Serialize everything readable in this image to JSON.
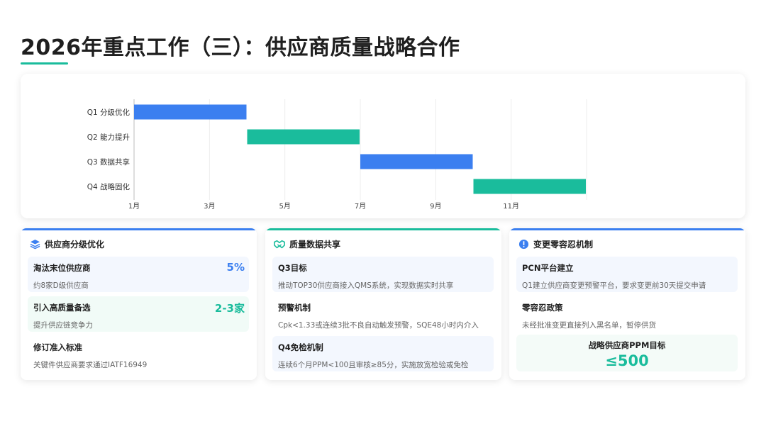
{
  "title": "2026年重点工作（三）：供应商质量战略合作",
  "colors": {
    "blue": "#3b7ff0",
    "green": "#1abc9c",
    "accent_line": "#1abc9c"
  },
  "chart_data": {
    "type": "gantt",
    "tasks": [
      {
        "label": "Q1 分级优化",
        "start": 1,
        "end": 4,
        "color": "#3b7ff0"
      },
      {
        "label": "Q2 能力提升",
        "start": 4,
        "end": 7,
        "color": "#1abc9c"
      },
      {
        "label": "Q3 数据共享",
        "start": 7,
        "end": 10,
        "color": "#3b7ff0"
      },
      {
        "label": "Q4 战略固化",
        "start": 10,
        "end": 13,
        "color": "#1abc9c"
      }
    ],
    "x_ticks": [
      {
        "value": 1,
        "label": "1月"
      },
      {
        "value": 3,
        "label": "3月"
      },
      {
        "value": 5,
        "label": "5月"
      },
      {
        "value": 7,
        "label": "7月"
      },
      {
        "value": 9,
        "label": "9月"
      },
      {
        "value": 11,
        "label": "11月"
      }
    ],
    "xlim": [
      1,
      13
    ],
    "grid": true
  },
  "cards": [
    {
      "title": "供应商分级优化",
      "icon": "layers-icon",
      "items": [
        {
          "title": "淘汰末位供应商",
          "sub": "约8家D级供应商",
          "value": "5%",
          "value_color": "#3b7ff0"
        },
        {
          "title": "引入高质量备选",
          "sub": "提升供应链竞争力",
          "value": "2-3家",
          "value_color": "#1abc9c"
        },
        {
          "title": "修订准入标准",
          "sub": "关键件供应商要求通过IATF16949",
          "value": ""
        }
      ]
    },
    {
      "title": "质量数据共享",
      "icon": "handshake-icon",
      "items": [
        {
          "title": "Q3目标",
          "sub": "推动TOP30供应商接入QMS系统，实现数据实时共享"
        },
        {
          "title": "预警机制",
          "sub": "Cpk<1.33或连续3批不良自动触发预警，SQE48小时内介入"
        },
        {
          "title": "Q4免检机制",
          "sub": "连续6个月PPM<100且审核≥85分，实施放宽检验或免检"
        }
      ]
    },
    {
      "title": "变更零容忍机制",
      "icon": "alert-icon",
      "items": [
        {
          "title": "PCN平台建立",
          "sub": "Q1建立供应商变更预警平台，要求变更前30天提交申请"
        },
        {
          "title": "零容忍政策",
          "sub": "未经批准变更直接列入黑名单，暂停供货"
        }
      ],
      "ppm_label": "战略供应商PPM目标",
      "ppm_value": "≤500"
    }
  ]
}
